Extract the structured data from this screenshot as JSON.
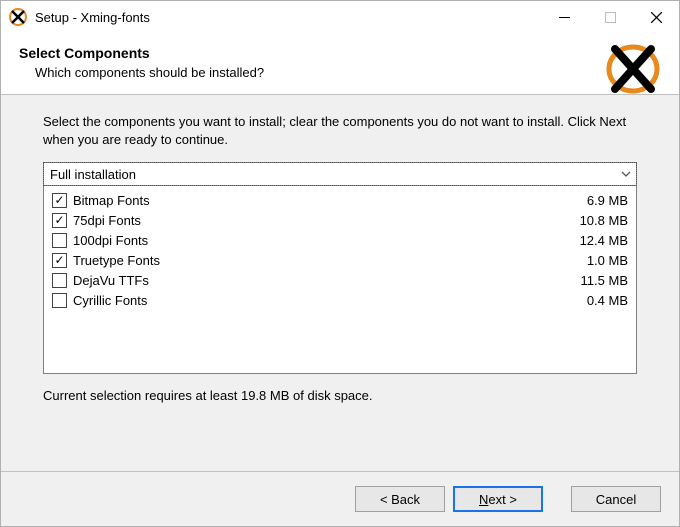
{
  "window": {
    "title": "Setup - Xming-fonts"
  },
  "header": {
    "heading": "Select Components",
    "subtext": "Which components should be installed?"
  },
  "content": {
    "description": "Select the components you want to install; clear the components you do not want to install. Click Next when you are ready to continue.",
    "dropdown_value": "Full installation",
    "items": [
      {
        "label": "Bitmap Fonts",
        "size": "6.9 MB",
        "checked": true
      },
      {
        "label": "75dpi Fonts",
        "size": "10.8 MB",
        "checked": true
      },
      {
        "label": "100dpi Fonts",
        "size": "12.4 MB",
        "checked": false
      },
      {
        "label": "Truetype Fonts",
        "size": "1.0 MB",
        "checked": true
      },
      {
        "label": "DejaVu TTFs",
        "size": "11.5 MB",
        "checked": false
      },
      {
        "label": "Cyrillic Fonts",
        "size": "0.4 MB",
        "checked": false
      }
    ],
    "space_required": "Current selection requires at least 19.8 MB of disk space."
  },
  "footer": {
    "back_label": "< Back",
    "next_prefix": "N",
    "next_suffix": "ext >",
    "cancel_label": "Cancel"
  }
}
